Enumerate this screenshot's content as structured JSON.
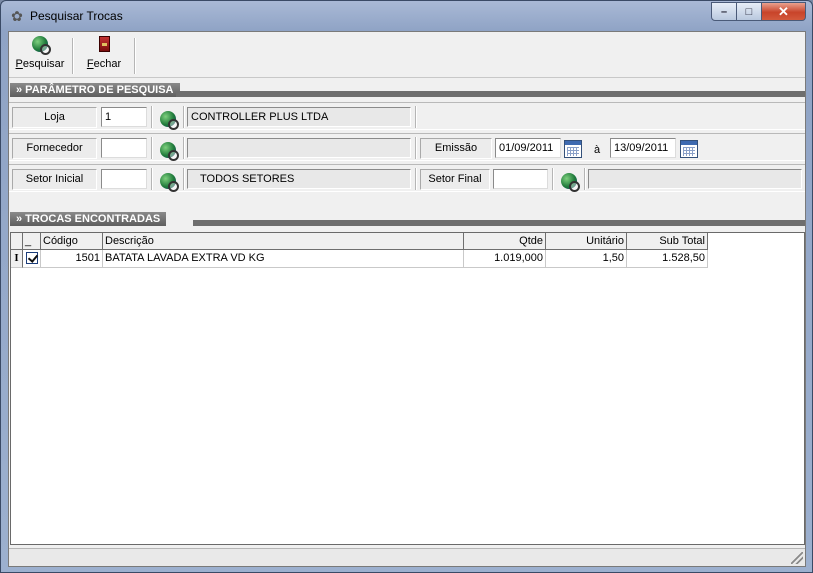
{
  "window": {
    "title": "Pesquisar Trocas",
    "min_glyph": "–",
    "max_glyph": "□",
    "close_glyph": "✕"
  },
  "toolbar": {
    "pesquisar": {
      "accel": "P",
      "rest": "esquisar"
    },
    "fechar": {
      "accel": "F",
      "rest": "echar"
    }
  },
  "sections": {
    "parametros": "» PARÂMETRO DE PESQUISA",
    "trocas": "» TROCAS ENCONTRADAS"
  },
  "filters": {
    "loja": {
      "label": "Loja",
      "value": "1",
      "name": "CONTROLLER PLUS LTDA"
    },
    "fornecedor": {
      "label": "Fornecedor",
      "value": "",
      "name": ""
    },
    "emissao": {
      "label": "Emissão",
      "from": "01/09/2011",
      "sep": "à",
      "to": "13/09/2011"
    },
    "setor_inicial": {
      "label": "Setor Inicial",
      "value": "",
      "name": "TODOS SETORES"
    },
    "setor_final": {
      "label": "Setor Final",
      "value": "",
      "name": ""
    }
  },
  "grid": {
    "columns": [
      "_",
      "Código",
      "Descrição",
      "Qtde",
      "Unitário",
      "Sub Total"
    ],
    "rows": [
      {
        "indicator": "I",
        "checked": true,
        "codigo": "1501",
        "descricao": "BATATA LAVADA EXTRA VD KG",
        "qtde": "1.019,000",
        "unitario": "1,50",
        "subtotal": "1.528,50"
      }
    ]
  },
  "icons": {
    "window": "gear-icon",
    "search": "globe-search-icon",
    "close": "door-exit-icon",
    "date": "calendar-icon"
  }
}
